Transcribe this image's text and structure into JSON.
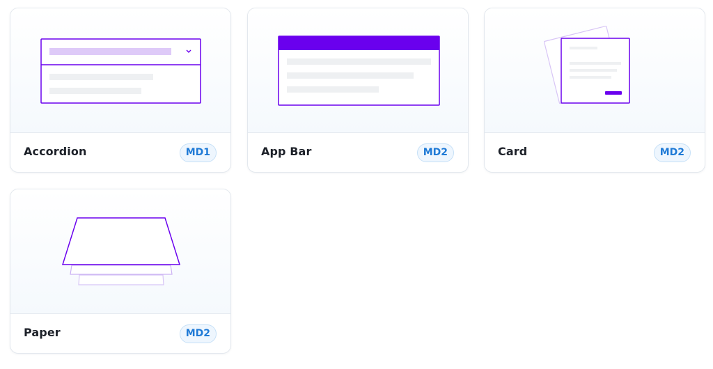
{
  "components": [
    {
      "name": "Accordion",
      "badge": "MD1",
      "illustration": "accordion-illustration"
    },
    {
      "name": "App Bar",
      "badge": "MD2",
      "illustration": "app-bar-illustration"
    },
    {
      "name": "Card",
      "badge": "MD2",
      "illustration": "card-illustration"
    },
    {
      "name": "Paper",
      "badge": "MD2",
      "illustration": "paper-illustration"
    }
  ],
  "colors": {
    "accent": "#6a00ee",
    "accent_light": "#decaf8",
    "placeholder": "#eef0f2",
    "badge_text": "#1f7ad6",
    "badge_bg": "#eef6fe",
    "badge_border": "#c6e0f7"
  }
}
